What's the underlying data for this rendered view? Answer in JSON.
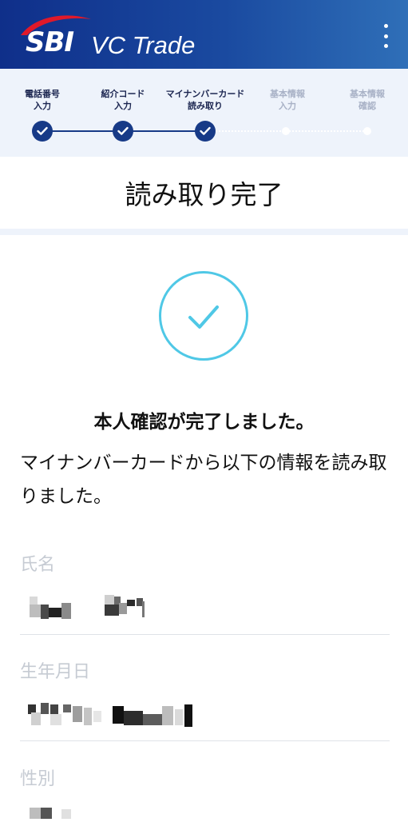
{
  "header": {
    "logo_mark": "SBI",
    "logo_text": "VC Trade"
  },
  "stepper": {
    "steps": [
      {
        "line1": "電話番号",
        "line2": "入力",
        "status": "done"
      },
      {
        "line1": "紹介コード",
        "line2": "入力",
        "status": "done"
      },
      {
        "line1": "マイナンバーカード",
        "line2": "読み取り",
        "status": "done"
      },
      {
        "line1": "基本情報",
        "line2": "入力",
        "status": "upcoming"
      },
      {
        "line1": "基本情報",
        "line2": "確認",
        "status": "upcoming"
      }
    ]
  },
  "page": {
    "title": "読み取り完了"
  },
  "result": {
    "heading": "本人確認が完了しました。",
    "description": "マイナンバーカードから以下の情報を読み取りました。"
  },
  "fields": [
    {
      "label": "氏名",
      "value_state": "redacted"
    },
    {
      "label": "生年月日",
      "value_state": "redacted"
    },
    {
      "label": "性別",
      "value_state": "redacted"
    }
  ],
  "colors": {
    "header_start": "#0f2f8a",
    "header_end": "#2f6fb8",
    "step_done": "#173a87",
    "stepper_bg": "#eef3fb",
    "success_ring": "#4fc8e6",
    "logo_swoosh": "#e0192a"
  },
  "icons": {
    "menu": "more-vertical-icon",
    "step_done": "check-icon",
    "success": "check-circle-icon"
  }
}
